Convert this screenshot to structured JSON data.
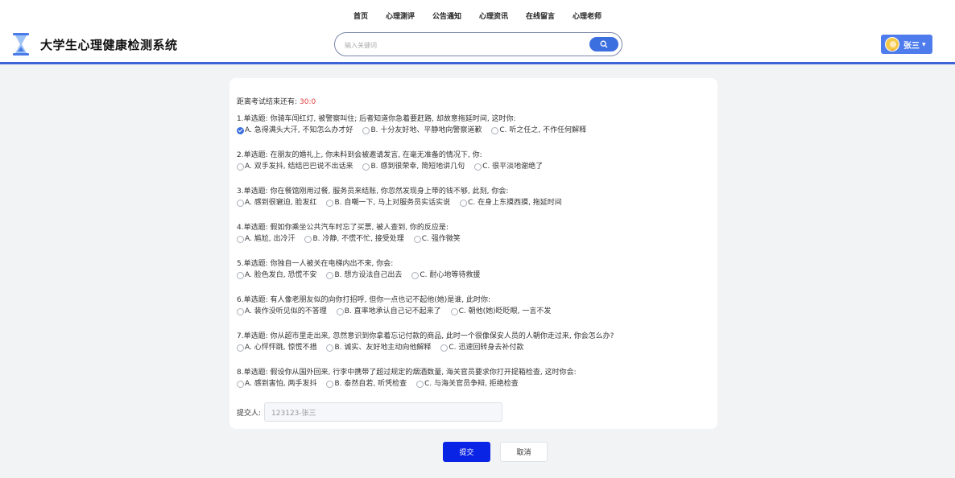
{
  "nav": [
    "首页",
    "心理测评",
    "公告通知",
    "心理资讯",
    "在线留言",
    "心理老师"
  ],
  "site": {
    "title": "大学生心理健康检测系统"
  },
  "search": {
    "placeholder": "输入关键词"
  },
  "user": {
    "name": "张三"
  },
  "exam": {
    "timer_label": "距离考试结束还有:",
    "timer_value": "30:0",
    "questions": [
      {
        "text": "1.单选题: 你骑车闯红灯, 被警察叫住; 后者知道你急着要赶路, 却故意拖延时间, 这时你:",
        "options": [
          "A. 急得满头大汗, 不知怎么办才好",
          "B. 十分友好地、平静地向警察道歉",
          "C. 听之任之, 不作任何解释"
        ],
        "selected": 0
      },
      {
        "text": "2.单选题: 在朋友的婚礼上, 你未料到会被邀请发言, 在毫无准备的情况下, 你:",
        "options": [
          "A. 双手发抖, 结结巴巴说不出话来",
          "B. 感到很荣幸, 简短地讲几句",
          "C. 很平淡地谢绝了"
        ],
        "selected": -1
      },
      {
        "text": "3.单选题: 你在餐馆刚用过餐, 服务员来结账, 你忽然发现身上带的钱不够, 此刻, 你会:",
        "options": [
          "A. 感到很窘迫, 脸发红",
          "B. 自嘲一下, 马上对服务员实话实说",
          "C. 在身上东摸西摸, 拖延时间"
        ],
        "selected": -1
      },
      {
        "text": "4.单选题: 假如你乘坐公共汽车时忘了买票, 被人查到, 你的反应是:",
        "options": [
          "A. 尴尬, 出冷汗",
          "B. 冷静, 不慌不忙, 接受处理",
          "C. 强作微笑"
        ],
        "selected": -1
      },
      {
        "text": "5.单选题: 你独自一人被关在电梯内出不来, 你会:",
        "options": [
          "A. 脸色发白, 恐慌不安",
          "B. 想方设法自己出去",
          "C. 耐心地等待救援"
        ],
        "selected": -1
      },
      {
        "text": "6.单选题: 有人像老朋友似的向你打招呼, 但你一点也记不起他(她)是谁, 此时你:",
        "options": [
          "A. 装作没听见似的不答理",
          "B. 直率地承认自己记不起来了",
          "C. 朝他(她)眨眨眼, 一言不发"
        ],
        "selected": -1
      },
      {
        "text": "7.单选题: 你从超市里走出来, 忽然意识到你拿着忘记付款的商品, 此时一个很像保安人员的人朝你走过来, 你会怎么办?",
        "options": [
          "A. 心怦怦跳, 惊慌不措",
          "B. 诚实、友好地主动向他解释",
          "C. 迅速回转身去补付款"
        ],
        "selected": -1
      },
      {
        "text": "8.单选题: 假设你从国外回来, 行李中携带了超过规定的烟酒数量, 海关官员要求你打开提箱检查, 这时你会:",
        "options": [
          "A. 感到害怕, 两手发抖",
          "B. 泰然自若, 听凭检查",
          "C. 与海关官员争辩, 拒绝检查"
        ],
        "selected": -1
      }
    ],
    "submitter_label": "提交人:",
    "submitter_value": "123123-张三"
  },
  "buttons": {
    "submit": "提交",
    "cancel": "取消"
  },
  "colors": {
    "accent": "#3b6fe0",
    "submit": "#0a24e6",
    "timer": "#e03b3b"
  }
}
